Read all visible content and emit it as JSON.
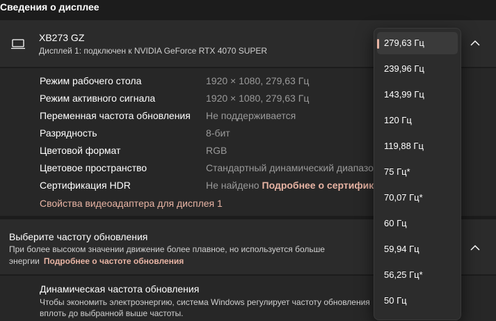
{
  "section_title": "Сведения о дисплее",
  "display": {
    "name": "XB273 GZ",
    "subtitle": "Дисплей 1: подключен к NVIDIA GeForce RTX 4070 SUPER",
    "icon": "monitor-icon"
  },
  "info": [
    {
      "label": "Режим рабочего стола",
      "value": "1920 × 1080, 279,63 Гц"
    },
    {
      "label": "Режим активного сигнала",
      "value": "1920 × 1080, 279,63 Гц"
    },
    {
      "label": "Переменная частота обновления",
      "value": "Не поддерживается"
    },
    {
      "label": "Разрядность",
      "value": "8-бит"
    },
    {
      "label": "Цветовой формат",
      "value": "RGB"
    },
    {
      "label": "Цветовое пространство",
      "value": "Стандартный динамический диапазо"
    },
    {
      "label": "Сертификация HDR",
      "value": "Не найдено",
      "link": "Подробнее о сертифика"
    }
  ],
  "adapter_link": "Свойства видеоадаптера для дисплея 1",
  "refresh": {
    "title": "Выберите частоту обновления",
    "description": "При более высоком значении движение более плавное, но используется больше энергии",
    "link": "Подробнее о частоте обновления"
  },
  "dynamic": {
    "title": "Динамическая частота обновления",
    "description": "Чтобы экономить электроэнергию, система Windows регулирует частоту обновления вплоть до выбранной выше частоты."
  },
  "dropdown": {
    "selected_index": 0,
    "options": [
      "279,63 Гц",
      "239,96 Гц",
      "143,99 Гц",
      "120 Гц",
      "119,88 Гц",
      "75 Гц*",
      "70,07 Гц*",
      "60 Гц",
      "59,94 Гц",
      "56,25 Гц*",
      "50 Гц"
    ]
  },
  "colors": {
    "accent": "#e8b4a4",
    "background": "#1c1c1c",
    "card": "#2b2b2b"
  }
}
